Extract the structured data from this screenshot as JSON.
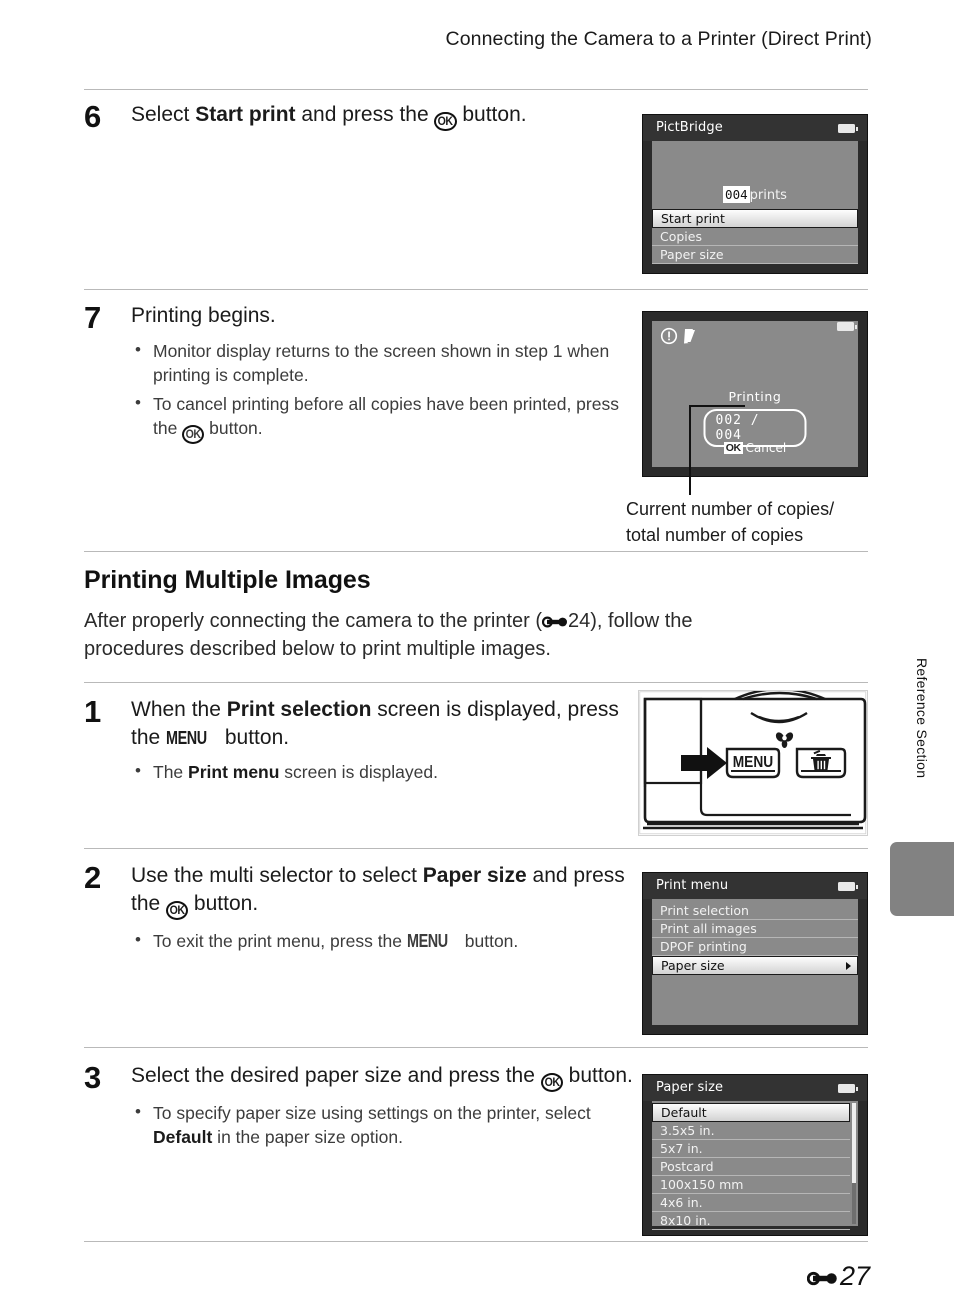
{
  "header": {
    "running_title": "Connecting the Camera to a Printer (Direct Print)"
  },
  "steps": [
    {
      "number": "6",
      "title_parts": [
        "Select ",
        "Start print",
        " and press the ",
        "OK-GLYPH",
        " button."
      ],
      "title_plain": "Select Start print and press the k button.",
      "bullets": []
    },
    {
      "number": "7",
      "title_plain": "Printing begins.",
      "bullets": [
        "Monitor display returns to the screen shown in step 1 when printing is complete.",
        "To cancel printing before all copies have been printed, press the OK button."
      ]
    },
    {
      "number": "1",
      "title_plain": "When the Print selection screen is displayed, press the MENU button.",
      "bullets": [
        "The Print menu screen is displayed."
      ]
    },
    {
      "number": "2",
      "title_plain": "Use the multi selector to select Paper size and press the OK button.",
      "bullets": [
        "To exit the print menu, press the MENU button."
      ]
    },
    {
      "number": "3",
      "title_plain": "Select the desired paper size and press the OK button.",
      "bullets": [
        "To specify paper size using settings on the printer, select Default in the paper size option."
      ]
    }
  ],
  "step6": {
    "lead": "Select ",
    "bold": "Start print",
    "mid": " and press the ",
    "tail": " button."
  },
  "step7": {
    "title": "Printing begins.",
    "bullet1_a": "Monitor display returns to the screen shown in step 1 when printing is complete.",
    "bullet2_a": "To cancel printing before all copies have been printed, press the ",
    "bullet2_b": " button."
  },
  "step1": {
    "lead": "When the ",
    "bold": "Print selection",
    "mid": " screen is displayed, press the ",
    "menu": "MENU",
    "tail": " button.",
    "bullet_a": "The ",
    "bullet_b": "Print menu",
    "bullet_c": " screen is displayed."
  },
  "step2": {
    "lead": "Use the multi selector to select ",
    "bold": "Paper size",
    "mid": " and press the ",
    "tail": " button.",
    "bullet_a": "To exit the print menu, press the ",
    "bullet_menu": "MENU",
    "bullet_b": " button."
  },
  "step3": {
    "lead": "Select the desired paper size and press the ",
    "tail": " button.",
    "bullet_a": "To specify paper size using settings on the printer, select ",
    "bullet_b": "Default",
    "bullet_c": " in the paper size option."
  },
  "section": {
    "heading": "Printing Multiple Images",
    "para_a": "After properly connecting the camera to the printer (",
    "para_ref": "24",
    "para_b": "), follow the procedures described below to print multiple images."
  },
  "lcd_pictbridge": {
    "title": "PictBridge",
    "prints_count": "004",
    "prints_label": "prints",
    "rows": [
      {
        "label": "Start print",
        "selected": true
      },
      {
        "label": "Copies",
        "selected": false
      },
      {
        "label": "Paper size",
        "selected": false
      }
    ]
  },
  "lcd_printing": {
    "icons": "ⓘ",
    "printing_label": "Printing",
    "counter": "002 / 004",
    "cancel_key": "OK",
    "cancel_label": "Cancel"
  },
  "caption_printing": {
    "line1": "Current number of copies/",
    "line2": "total number of copies"
  },
  "camera_illustration": {
    "menu_button_label": "MENU",
    "delete_icon": "trash-icon",
    "macro_icon": "macro-flower-icon",
    "arrow_icon": "right-arrow-icon"
  },
  "lcd_print_menu": {
    "title": "Print menu",
    "rows": [
      {
        "label": "Print selection",
        "selected": false
      },
      {
        "label": "Print all images",
        "selected": false
      },
      {
        "label": "DPOF printing",
        "selected": false
      },
      {
        "label": "Paper size",
        "selected": true,
        "has_arrow": true
      }
    ]
  },
  "lcd_paper_size": {
    "title": "Paper size",
    "rows": [
      {
        "label": "Default",
        "selected": true
      },
      {
        "label": "3.5x5 in.",
        "selected": false
      },
      {
        "label": "5x7 in.",
        "selected": false
      },
      {
        "label": "Postcard",
        "selected": false
      },
      {
        "label": "100x150 mm",
        "selected": false
      },
      {
        "label": "4x6 in.",
        "selected": false
      },
      {
        "label": "8x10 in.",
        "selected": false
      }
    ]
  },
  "side": {
    "section_label": "Reference Section"
  },
  "footer": {
    "page_number": "27"
  },
  "colors": {
    "lcd_frame": "#2b2b2b",
    "lcd_titlebar": "#333333",
    "lcd_background": "#8a8a8a",
    "rule": "#b9b9b9",
    "side_tab": "#828282",
    "text": "#1b1b1b"
  }
}
